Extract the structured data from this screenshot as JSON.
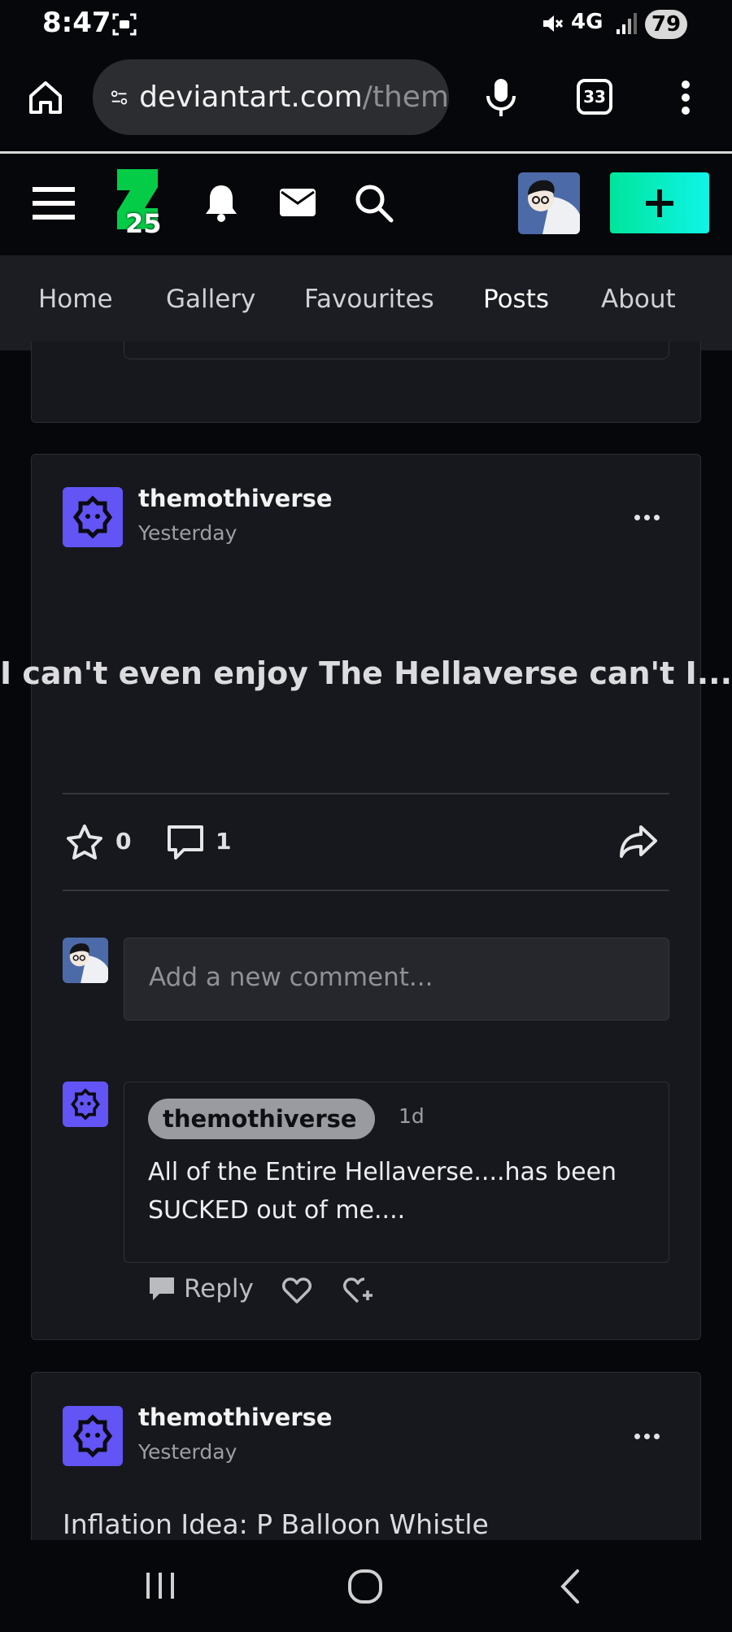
{
  "status_bar": {
    "time": "8:47",
    "network": "4G",
    "battery": "79"
  },
  "browser": {
    "url_main": "deviantart.com",
    "url_rest": "/them",
    "tab_count": "33"
  },
  "tabs": [
    {
      "label": "Home",
      "active": false
    },
    {
      "label": "Gallery",
      "active": false
    },
    {
      "label": "Favourites",
      "active": false
    },
    {
      "label": "Posts",
      "active": true
    },
    {
      "label": "About",
      "active": false
    }
  ],
  "logo_badge": "25",
  "post": {
    "author": "themothiverse",
    "time": "Yesterday",
    "title": "I can't even enjoy The Hellaverse can't I...?",
    "favourites": "0",
    "comments": "1",
    "comment_placeholder": "Add a new comment..."
  },
  "comment": {
    "author": "themothiverse",
    "time": "1d",
    "text": "All of the Entire Hellaverse....has been SUCKED out of me....",
    "reply_label": "Reply"
  },
  "next_post": {
    "author": "themothiverse",
    "time": "Yesterday",
    "title": "Inflation Idea: P Balloon Whistle"
  },
  "colors": {
    "accent": "#2ad9a0",
    "create_button": "#00e59b",
    "author_avatar": "#6254f5"
  }
}
